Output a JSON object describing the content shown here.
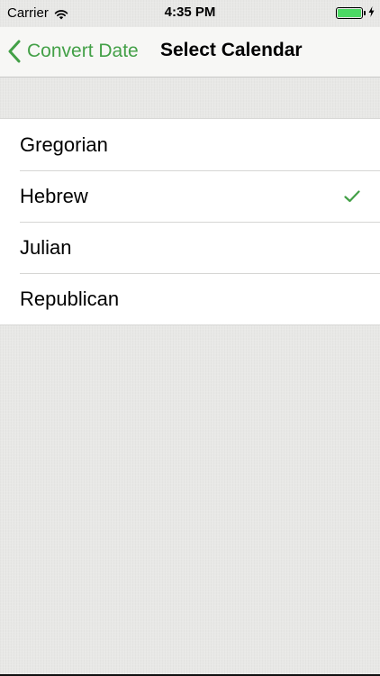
{
  "status_bar": {
    "carrier": "Carrier",
    "time": "4:35 PM",
    "wifi_icon": "wifi-icon",
    "battery_icon": "battery-icon",
    "battery_level": 1.0,
    "charging_icon": "bolt-icon"
  },
  "nav": {
    "back_label": "Convert Date",
    "back_icon": "chevron-left-icon",
    "title": "Select Calendar"
  },
  "calendars": {
    "items": [
      {
        "label": "Gregorian",
        "selected": false
      },
      {
        "label": "Hebrew",
        "selected": true
      },
      {
        "label": "Julian",
        "selected": false
      },
      {
        "label": "Republican",
        "selected": false
      }
    ]
  },
  "colors": {
    "accent": "#43a047",
    "battery": "#4cd964",
    "background": "#e8e8e6"
  }
}
